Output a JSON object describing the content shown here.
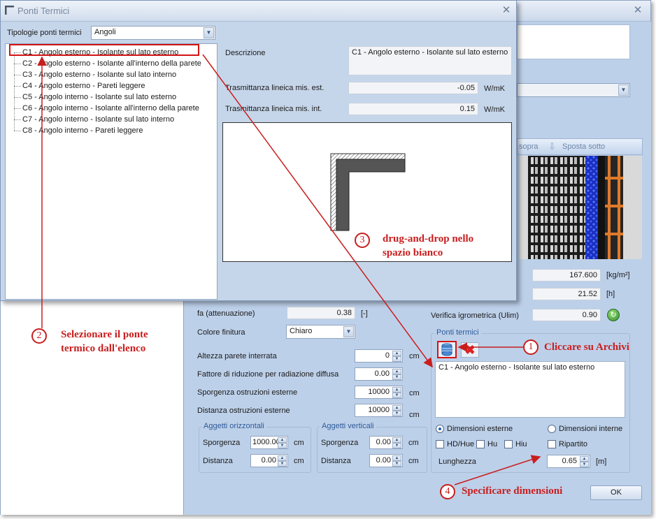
{
  "front_dialog": {
    "title": "Ponti Termici",
    "typology_label": "Tipologie ponti termici",
    "typology_value": "Angoli",
    "tree_items": [
      "C1 - Angolo esterno - Isolante sul lato esterno",
      "C2 - Angolo esterno - Isolante all'interno della parete",
      "C3 - Angolo esterno - Isolante sul lato interno",
      "C4 - Angolo esterno - Pareti leggere",
      "C5 - Angolo interno - Isolante sul lato esterno",
      "C6 - Angolo interno - Isolante all'interno della parete",
      "C7 - Angolo interno - Isolante sul lato interno",
      "C8 - Angolo interno - Pareti leggere"
    ],
    "description_label": "Descrizione",
    "description_value": "C1 - Angolo esterno - Isolante sul lato esterno",
    "trasm_est_label": "Trasmittanza lineica mis. est.",
    "trasm_est_value": "-0.05",
    "trasm_est_unit": "W/mK",
    "trasm_int_label": "Trasmittanza lineica mis. int.",
    "trasm_int_value": "0.15",
    "trasm_int_unit": "W/mK"
  },
  "back_window": {
    "toolbar_sopra": "sopra",
    "toolbar_sposta_sotto": "Sposta sotto",
    "massa_value": "167.600",
    "massa_unit": "[kg/m²]",
    "sfasamento_value": "21.52",
    "sfasamento_unit": "[h]",
    "fa_label": "fa (attenuazione)",
    "fa_value": "0.38",
    "fa_unit": "[-]",
    "verifica_label": "Verifica igrometrica (Ulim)",
    "verifica_value": "0.90",
    "colore_label": "Colore finitura",
    "colore_value": "Chiaro",
    "altezza_label": "Altezza parete interrata",
    "altezza_value": "0",
    "altezza_unit": "cm",
    "fattore_label": "Fattore di riduzione per radiazione diffusa",
    "fattore_value": "0.00",
    "sporgenza_ostr_label": "Sporgenza ostruzioni esterne",
    "sporgenza_ostr_value": "10000",
    "sporgenza_ostr_unit": "cm",
    "distanza_ostr_label": "Distanza ostruzioni esterne",
    "distanza_ostr_value": "10000",
    "distanza_ostr_unit": "cm",
    "aggetti_orizz": {
      "title": "Aggetti orizzontali",
      "sporgenza_label": "Sporgenza",
      "sporgenza_value": "1000.00",
      "sporgenza_unit": "cm",
      "distanza_label": "Distanza",
      "distanza_value": "0.00",
      "distanza_unit": "cm"
    },
    "aggetti_vert": {
      "title": "Aggetti verticali",
      "sporgenza_label": "Sporgenza",
      "sporgenza_value": "0.00",
      "sporgenza_unit": "cm",
      "distanza_label": "Distanza",
      "distanza_value": "0.00",
      "distanza_unit": "cm"
    },
    "ponti": {
      "title": "Ponti termici",
      "list_item": "C1 - Angolo esterno - Isolante sul lato esterno",
      "dim_esterne": "Dimensioni esterne",
      "dim_interne": "Dimensioni interne",
      "hd_hue": "HD/Hue",
      "hu": "Hu",
      "hiu": "Hiu",
      "ripartito": "Ripartito",
      "lunghezza_label": "Lunghezza",
      "lunghezza_value": "0.65",
      "lunghezza_unit": "[m]"
    },
    "ok_label": "OK"
  },
  "annotations": {
    "n1": "1",
    "n2": "2",
    "n3": "3",
    "n4": "4",
    "a1": "Cliccare su Archivi",
    "a2_line1": "Selezionare il ponte",
    "a2_line2": "termico dall'elenco",
    "a3_line1": "drug-and-drop nello",
    "a3_line2": "spazio bianco",
    "a4": "Specificare dimensioni"
  },
  "colors": {
    "annotation_red": "#c81e1e",
    "panel_blue": "#c6d6ea"
  }
}
